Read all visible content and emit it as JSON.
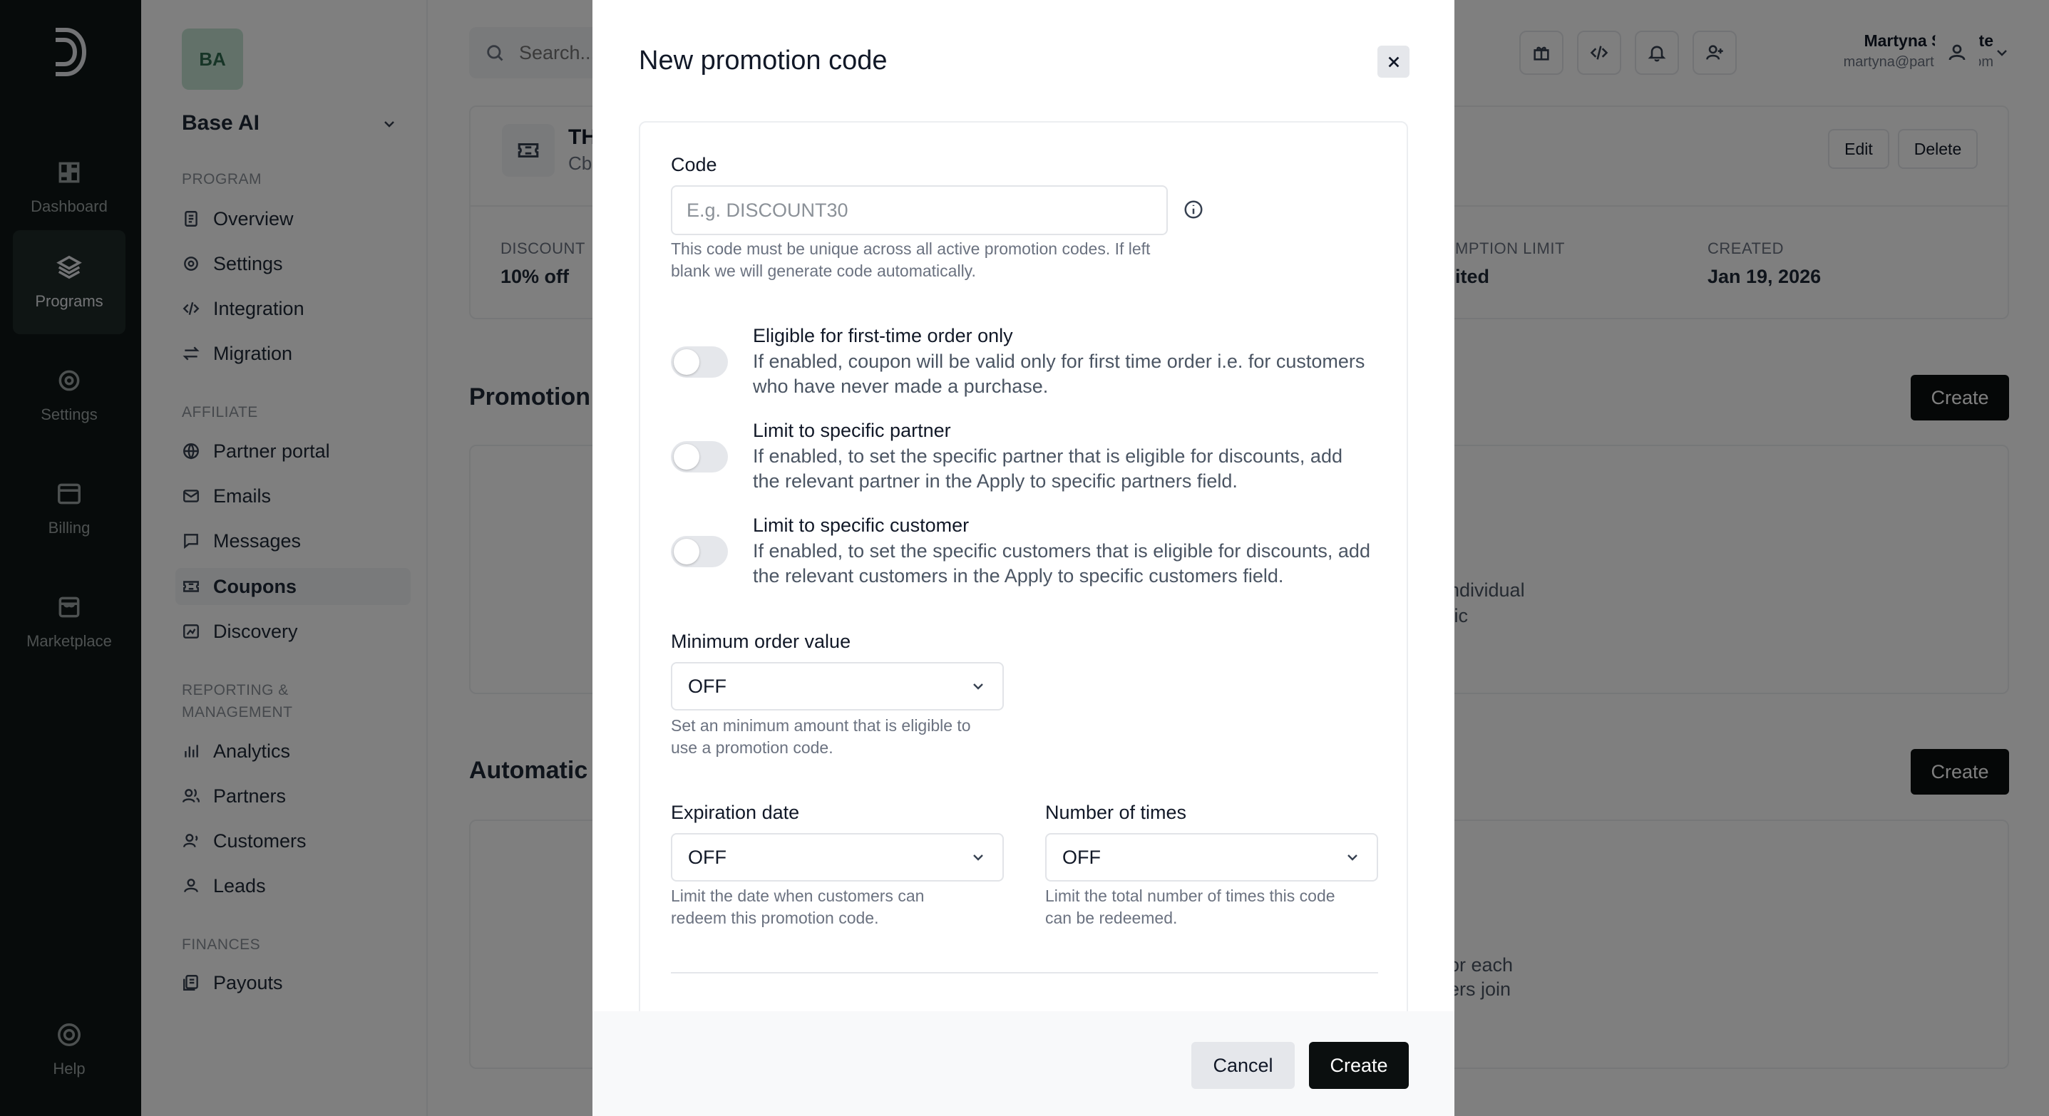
{
  "rail": {
    "items": [
      {
        "label": "Dashboard",
        "icon": "dashboard-icon"
      },
      {
        "label": "Programs",
        "icon": "layers-icon"
      },
      {
        "label": "Settings",
        "icon": "gear-icon"
      },
      {
        "label": "Billing",
        "icon": "billing-icon"
      },
      {
        "label": "Marketplace",
        "icon": "store-icon"
      }
    ],
    "help": "Help"
  },
  "sidebar": {
    "org_initials": "BA",
    "org_name": "Base AI",
    "sections": [
      {
        "title": "PROGRAM",
        "items": [
          "Overview",
          "Settings",
          "Integration",
          "Migration"
        ]
      },
      {
        "title": "AFFILIATE",
        "items": [
          "Partner portal",
          "Emails",
          "Messages",
          "Coupons",
          "Discovery"
        ]
      },
      {
        "title_line1": "REPORTING &",
        "title_line2": "MANAGEMENT",
        "items": [
          "Analytics",
          "Partners",
          "Customers",
          "Leads"
        ]
      },
      {
        "title": "FINANCES",
        "items": [
          "Payouts"
        ]
      }
    ],
    "active_item": "Coupons"
  },
  "header": {
    "search_placeholder": "Search...",
    "user_name": "Martyna Slevaite",
    "user_email": "martyna@partnero.com"
  },
  "background": {
    "coupon_title": "TH",
    "coupon_sub": "Cb",
    "edit_label": "Edit",
    "delete_label": "Delete",
    "stats": [
      {
        "label": "DISCOUNT",
        "value": "10% off"
      },
      {
        "label": "MPTION LIMIT",
        "value": "ited"
      },
      {
        "label": "CREATED",
        "value": "Jan 19, 2026"
      }
    ],
    "promotion_heading": "Promotion c",
    "automatic_heading": "Automatic p",
    "create_label": "Create",
    "promo_text_1": "ndividual",
    "promo_text_2": "fic",
    "auto_text_1": "or each",
    "auto_text_2": "ers join"
  },
  "modal": {
    "title": "New promotion code",
    "code_label": "Code",
    "code_placeholder": "E.g. DISCOUNT30",
    "code_help_1": "This code must be unique across all active promotion codes. If left",
    "code_help_2": "blank we will generate code automatically.",
    "toggles": [
      {
        "title": "Eligible for first-time order only",
        "desc_1": "If enabled, coupon will be valid only for first time order i.e. for customers",
        "desc_2": "who have never made a purchase.",
        "enabled": false
      },
      {
        "title": "Limit to specific partner",
        "desc_1": "If enabled, to set the specific partner that is eligible for discounts, add",
        "desc_2": "the relevant partner in the Apply to specific partners field.",
        "enabled": false
      },
      {
        "title": "Limit to specific customer",
        "desc_1": "If enabled, to set the specific customers that is eligible for discounts, add",
        "desc_2": "the relevant customers in the Apply to specific customers field.",
        "enabled": false
      }
    ],
    "min_order_label": "Minimum order value",
    "min_order_value": "OFF",
    "min_order_help_1": "Set an minimum amount that is eligible to",
    "min_order_help_2": "use a promotion code.",
    "expiration_label": "Expiration date",
    "expiration_value": "OFF",
    "expiration_help_1": "Limit the date when customers can",
    "expiration_help_2": "redeem this promotion code.",
    "times_label": "Number of times",
    "times_value": "OFF",
    "times_help_1": "Limit the total number of times this code",
    "times_help_2": "can be redeemed.",
    "cancel_label": "Cancel",
    "create_label": "Create"
  }
}
